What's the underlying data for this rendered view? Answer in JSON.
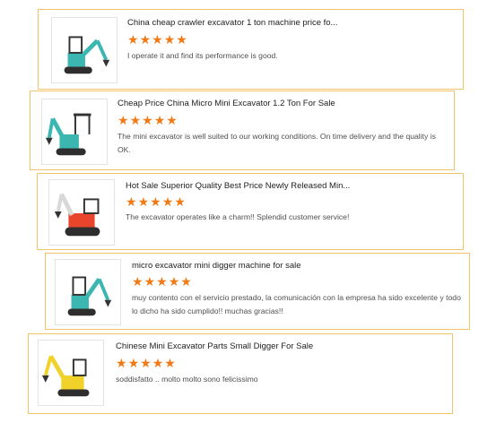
{
  "colors": {
    "border": "#f2c36b",
    "star": "#f17a16",
    "teal": "#3bb6b1",
    "red": "#e8452c",
    "yellow": "#f1d22a"
  },
  "star_icon": "★",
  "reviews": [
    {
      "title": "China cheap crawler excavator 1 ton machine price fo...",
      "rating": 5,
      "text": "I operate it and find its performance is good.",
      "image_icon": "teal-mini-excavator-image"
    },
    {
      "title": "Cheap Price China Micro Mini Excavator 1.2 Ton For Sale",
      "rating": 5,
      "text": "The mini excavator is well suited to our working conditions. On time delivery and the quality is OK.",
      "image_icon": "teal-canopy-excavator-image"
    },
    {
      "title": "Hot Sale Superior Quality Best Price Newly Released Min...",
      "rating": 5,
      "text": "The excavator operates like a charm!! Splendid customer service!",
      "image_icon": "red-mini-excavator-image"
    },
    {
      "title": "micro excavator mini digger machine for sale",
      "rating": 5,
      "text": "muy contento con el servicio prestado, la comunicación con la empresa ha sido excelente y todo lo dicho ha sido cumplido!! muchas gracias!!",
      "image_icon": "teal-mini-digger-image"
    },
    {
      "title": "Chinese Mini Excavator Parts Small Digger For Sale",
      "rating": 5,
      "text": "soddisfatto .. molto molto sono felicissimo",
      "image_icon": "yellow-mini-excavator-image"
    }
  ]
}
